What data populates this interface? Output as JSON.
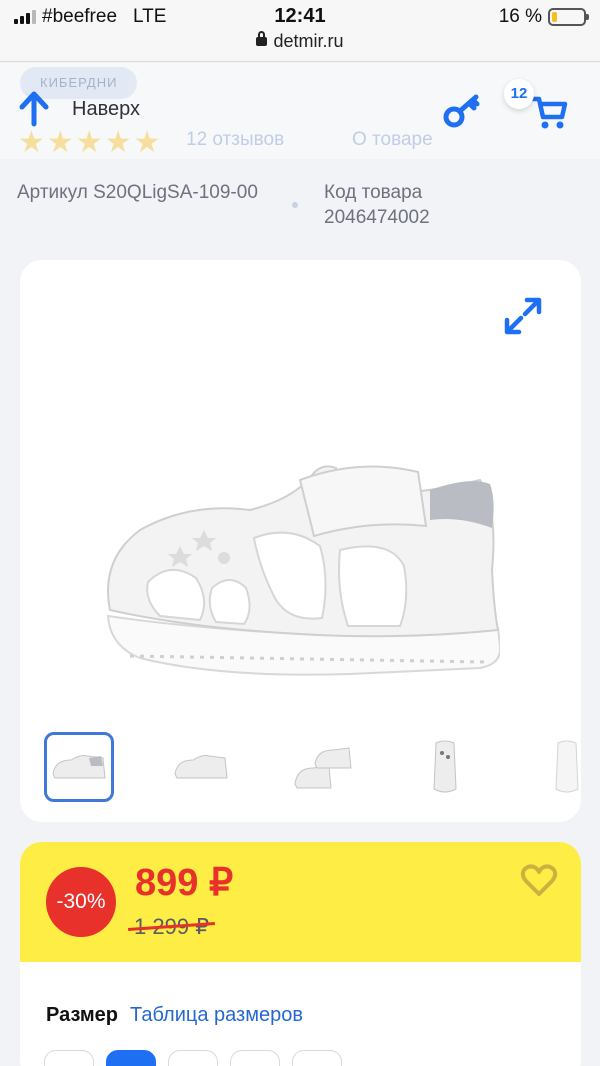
{
  "status_bar": {
    "carrier": "#beefree",
    "network": "LTE",
    "time": "12:41",
    "url": "detmir.ru",
    "battery": "16 %",
    "battery_level": 0.16
  },
  "header": {
    "faded_badge": "КИБЕРДНИ",
    "faded_reviews": "12 отзывов",
    "faded_about": "О товаре",
    "up_label": "Наверх",
    "cart_count": "12"
  },
  "product": {
    "article": "Артикул S20QLigSA-109-00",
    "code_label": "Код товара",
    "code_value": "2046474002",
    "thumbnails": [
      "sandal-front",
      "sandal-side",
      "sandal-pair",
      "sandal-top",
      "sandal-sole",
      "sandal-pair-2"
    ],
    "active_thumbnail": 0
  },
  "price": {
    "discount": "-30%",
    "current": "899 ₽",
    "old": "1 299 ₽"
  },
  "size": {
    "title": "Размер",
    "table_link": "Таблица размеров"
  },
  "colors": {
    "accent_blue": "#1e6ff1",
    "price_red": "#e7312a",
    "price_band_yellow": "#fded44"
  }
}
